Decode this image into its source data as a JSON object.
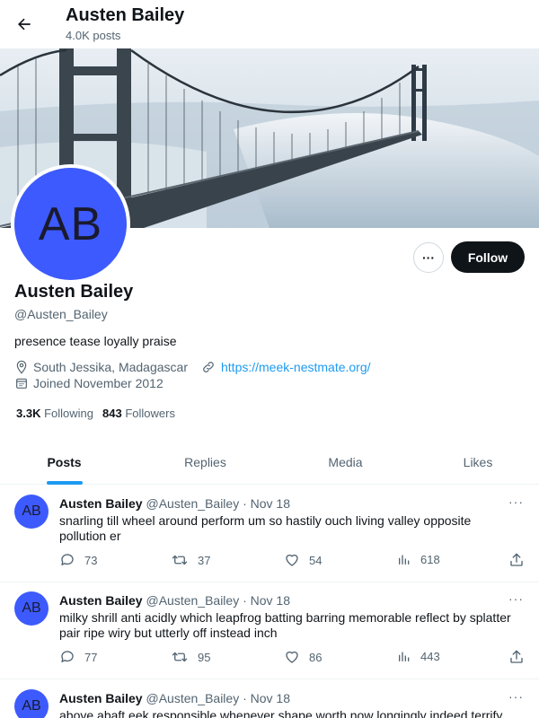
{
  "header": {
    "title": "Austen Bailey",
    "post_count": "4.0K posts"
  },
  "profile": {
    "avatar_initials": "AB",
    "display_name": "Austen Bailey",
    "handle": "@Austen_Bailey",
    "bio": "presence tease loyally praise",
    "location": "South Jessika, Madagascar",
    "website": "https://meek-nestmate.org/",
    "joined": "Joined November 2012",
    "following_count": "3.3K",
    "following_label": "Following",
    "followers_count": "843",
    "followers_label": "Followers",
    "follow_label": "Follow",
    "more_label": "···"
  },
  "tabs": [
    {
      "label": "Posts",
      "active": true
    },
    {
      "label": "Replies",
      "active": false
    },
    {
      "label": "Media",
      "active": false
    },
    {
      "label": "Likes",
      "active": false
    }
  ],
  "posts": [
    {
      "avatar_initials": "AB",
      "name": "Austen Bailey",
      "handle": "@Austen_Bailey",
      "date": "· Nov 18",
      "text": "snarling till wheel around perform um so hastily ouch living valley opposite pollution er",
      "replies": "73",
      "reposts": "37",
      "likes": "54",
      "views": "618"
    },
    {
      "avatar_initials": "AB",
      "name": "Austen Bailey",
      "handle": "@Austen_Bailey",
      "date": "· Nov 18",
      "text": "milky shrill anti acidly which leapfrog batting barring memorable reflect by splatter pair ripe wiry but utterly off instead inch",
      "replies": "77",
      "reposts": "95",
      "likes": "86",
      "views": "443"
    },
    {
      "avatar_initials": "AB",
      "name": "Austen Bailey",
      "handle": "@Austen_Bailey",
      "date": "· Nov 18",
      "text": "above abaft eek responsible whenever shape worth now longingly indeed terrify",
      "replies": "",
      "reposts": "",
      "likes": "",
      "views": ""
    }
  ],
  "colors": {
    "accent": "#1d9bf0",
    "avatar_bg": "#3d5afe",
    "text_primary": "#0f1419",
    "text_secondary": "#536471"
  },
  "icons": [
    "back-arrow-icon",
    "more-icon",
    "location-icon",
    "link-icon",
    "calendar-icon",
    "reply-icon",
    "repost-icon",
    "like-icon",
    "views-icon",
    "share-icon"
  ]
}
